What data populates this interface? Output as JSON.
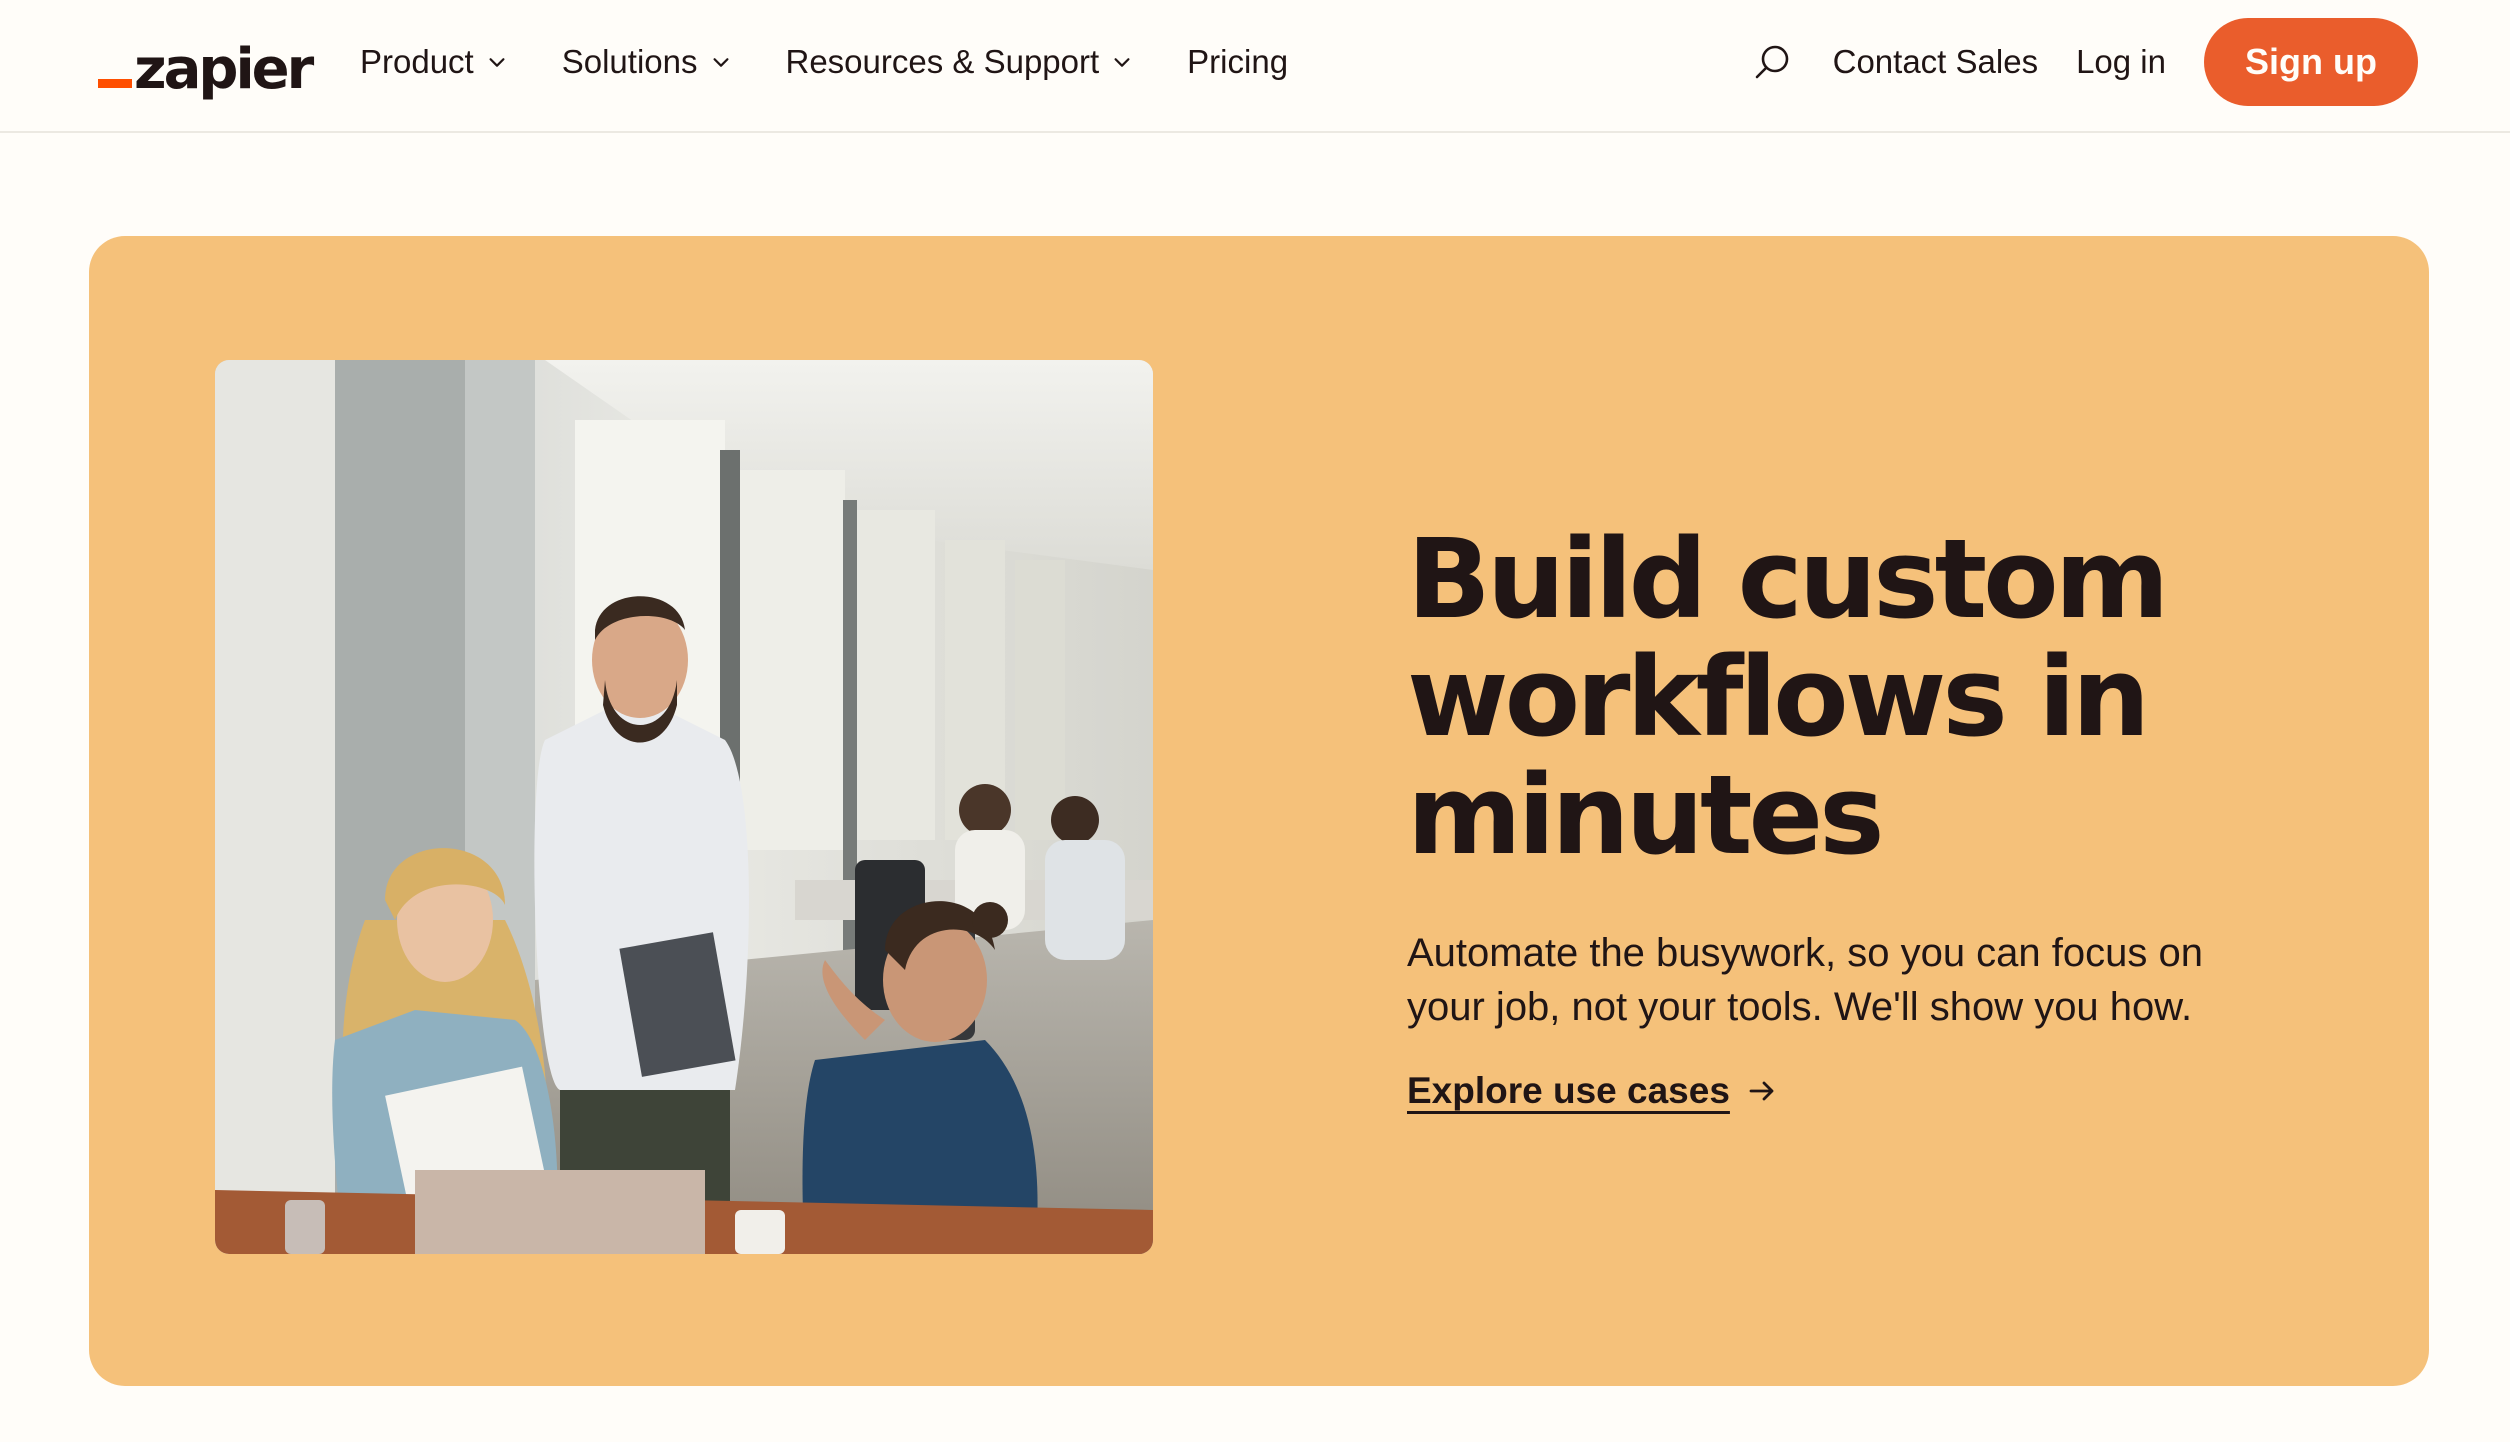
{
  "header": {
    "logo_text": "zapier",
    "nav": [
      {
        "label": "Product",
        "has_dropdown": true
      },
      {
        "label": "Solutions",
        "has_dropdown": true
      },
      {
        "label": "Resources & Support",
        "has_dropdown": true
      },
      {
        "label": "Pricing",
        "has_dropdown": false
      }
    ],
    "search_icon": "search-icon",
    "contact_sales": "Contact Sales",
    "login": "Log in",
    "signup": "Sign up"
  },
  "hero": {
    "title": "Build custom workflows in minutes",
    "subtitle": "Automate the busywork, so you can focus on your job, not your tools. We'll show you how.",
    "cta_label": "Explore use cases",
    "cta_icon": "arrow-right-icon",
    "image_alt": "office-team-meeting-photo"
  },
  "colors": {
    "brand_orange": "#ff4f00",
    "signup_bg": "#ea5d2c",
    "hero_bg": "#f5c17a",
    "text_dark": "#201515",
    "page_bg": "#fffdf9"
  }
}
